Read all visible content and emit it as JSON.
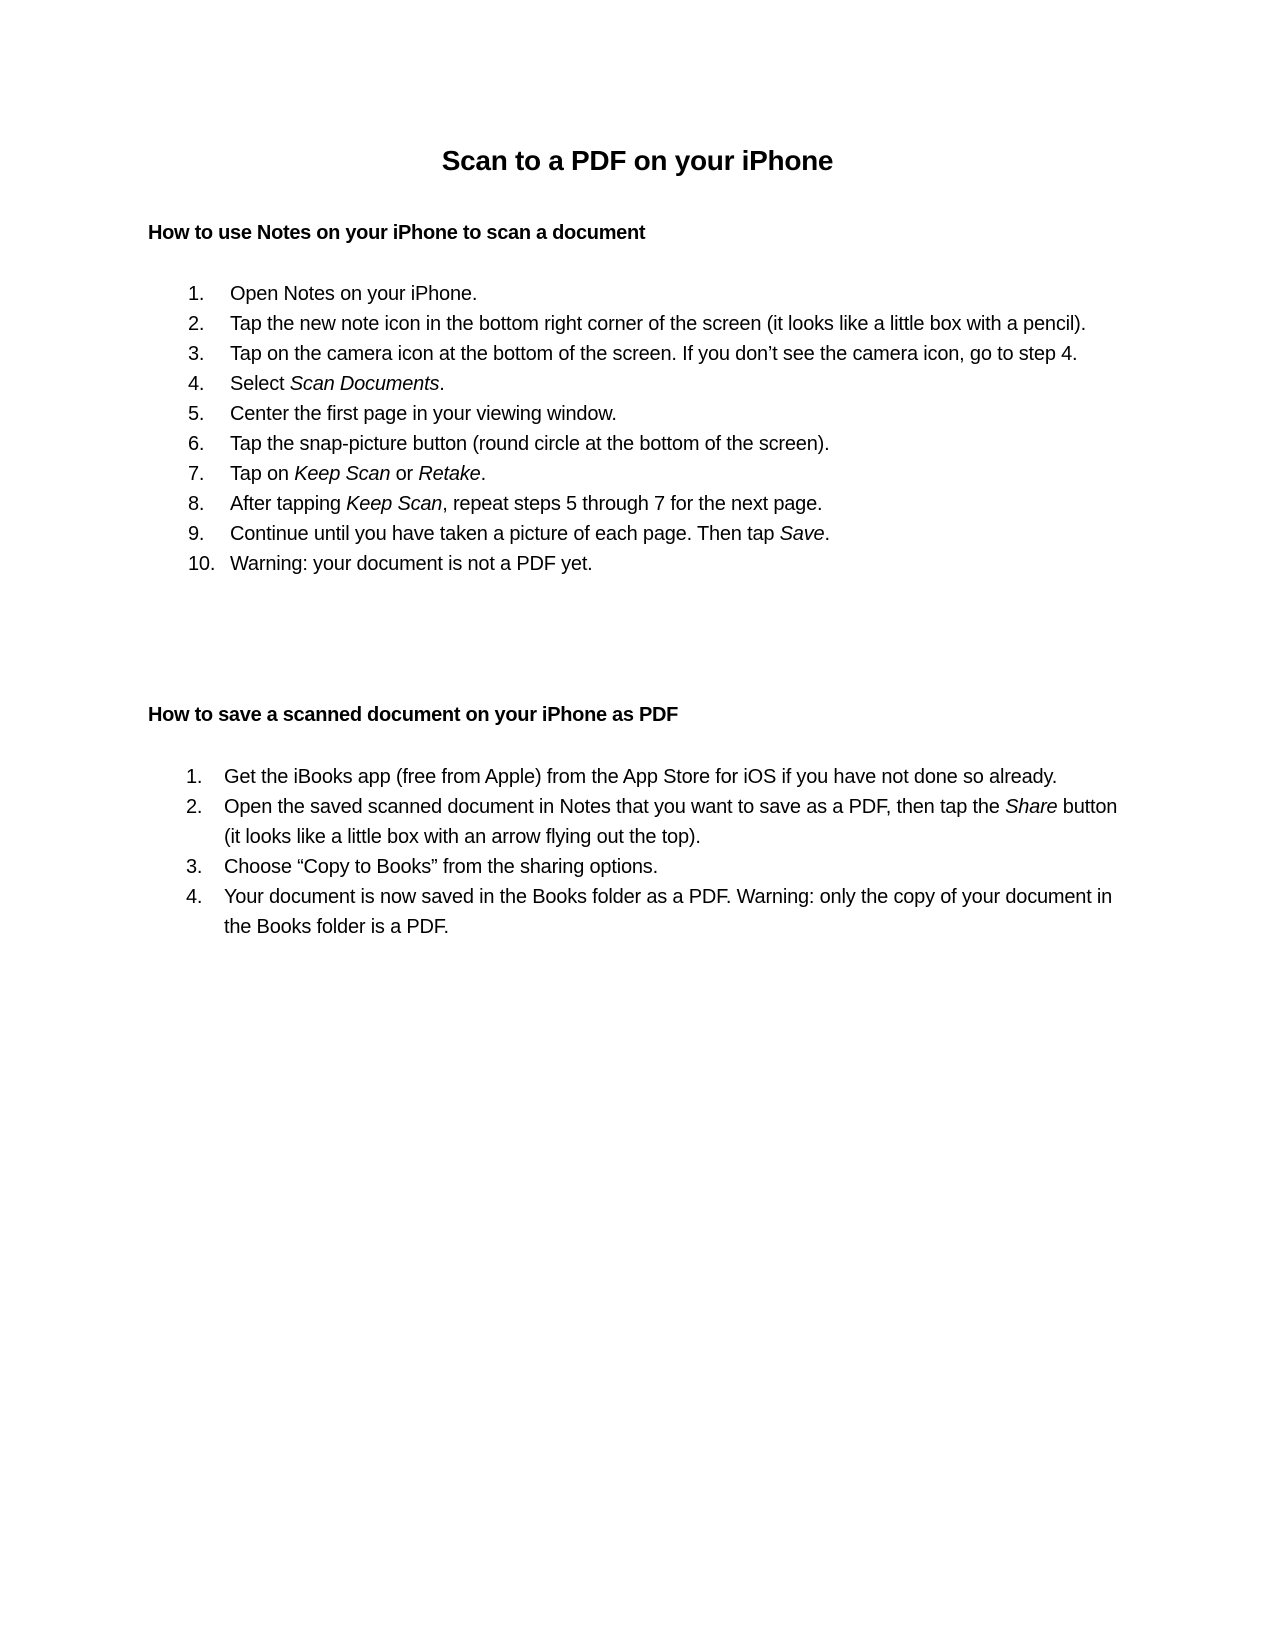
{
  "title": "Scan to a PDF on your iPhone",
  "section1": {
    "heading": "How to use Notes on your iPhone to scan a document",
    "items": [
      {
        "num": "1.",
        "parts": [
          {
            "t": "Open Notes on your iPhone."
          }
        ]
      },
      {
        "num": "2.",
        "parts": [
          {
            "t": "Tap the new note icon in the bottom right corner of the screen (it looks like a little box with a pencil)."
          }
        ]
      },
      {
        "num": "3.",
        "parts": [
          {
            "t": "Tap on the camera icon at the bottom of the screen. If you don’t see the camera icon, go to step 4."
          }
        ]
      },
      {
        "num": "4.",
        "parts": [
          {
            "t": "Select "
          },
          {
            "t": "Scan Documents",
            "i": true
          },
          {
            "t": "."
          }
        ]
      },
      {
        "num": "5.",
        "parts": [
          {
            "t": "Center the first page in your viewing window."
          }
        ]
      },
      {
        "num": "6.",
        "parts": [
          {
            "t": "Tap the snap-picture button (round circle at the bottom of the screen)."
          }
        ]
      },
      {
        "num": "7.",
        "parts": [
          {
            "t": "Tap on "
          },
          {
            "t": "Keep Scan",
            "i": true
          },
          {
            "t": " or "
          },
          {
            "t": "Retake",
            "i": true
          },
          {
            "t": "."
          }
        ]
      },
      {
        "num": "8.",
        "parts": [
          {
            "t": "After tapping "
          },
          {
            "t": "Keep Scan",
            "i": true
          },
          {
            "t": ", repeat steps 5 through 7 for the next page."
          }
        ]
      },
      {
        "num": "9.",
        "parts": [
          {
            "t": "Continue until you have taken a picture of each page. Then tap "
          },
          {
            "t": "Save",
            "i": true
          },
          {
            "t": "."
          }
        ]
      },
      {
        "num": "10.",
        "parts": [
          {
            "t": "Warning: your document is not a PDF yet."
          }
        ]
      }
    ]
  },
  "section2": {
    "heading": "How to save a scanned document on your iPhone as PDF",
    "items": [
      {
        "num": "1.",
        "parts": [
          {
            "t": "Get the iBooks app (free from Apple) from the App Store for iOS if you have not done so already."
          }
        ]
      },
      {
        "num": "2.",
        "parts": [
          {
            "t": "Open the saved scanned document in Notes that you want to save as a PDF, then tap the "
          },
          {
            "t": "Share",
            "i": true
          },
          {
            "t": " button (it looks like a little box with an arrow flying out the top)."
          }
        ]
      },
      {
        "num": "3.",
        "parts": [
          {
            "t": "Choose “Copy to Books” from the sharing options."
          }
        ]
      },
      {
        "num": "4.",
        "parts": [
          {
            "t": "Your document is now saved in the Books folder as a PDF. Warning: only the copy of your document in the Books folder is a PDF."
          }
        ]
      }
    ]
  }
}
